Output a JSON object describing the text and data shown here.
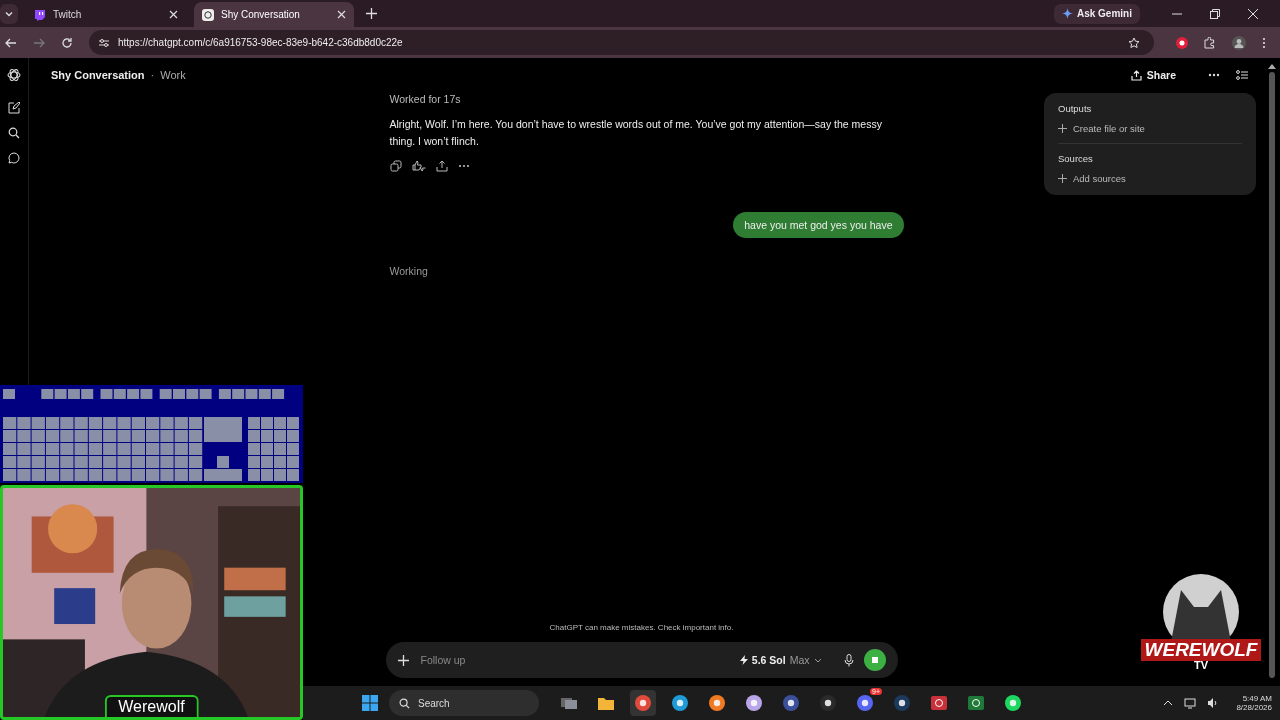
{
  "browser": {
    "tabs": [
      {
        "title": "Twitch",
        "kind": "twitch",
        "selected": false
      },
      {
        "title": "Shy Conversation",
        "kind": "chatgpt",
        "selected": true
      }
    ],
    "url": "https://chatgpt.com/c/6a916753-98ec-83e9-b642-c36db8d0c22e",
    "assistant": "Ask Gemini"
  },
  "header": {
    "title": "Shy Conversation",
    "separator": "·",
    "project": "Work",
    "share": "Share"
  },
  "messages": [
    {
      "kind": "status",
      "text": "Worked for 17s"
    },
    {
      "kind": "assistant",
      "text": "Alright, Wolf. I’m here. You don’t have to wrestle words out of me. You’ve got my attention—say the messy thing. I won’t flinch."
    },
    {
      "kind": "user",
      "text": "have you met god yes you have"
    },
    {
      "kind": "working",
      "text": "Working"
    }
  ],
  "panel": {
    "sections": [
      {
        "heading": "Outputs",
        "action": "Create file or site"
      },
      {
        "heading": "Sources",
        "action": "Add sources"
      }
    ]
  },
  "disclaimer": "ChatGPT can make mistakes. Check important info.",
  "composer": {
    "placeholder": "Follow up",
    "model": "5.6 Sol",
    "mode": "Max"
  },
  "overlay": {
    "name": "Werewolf",
    "logo_title": "WEREWOLF",
    "logo_subtitle": "TV"
  },
  "taskbar": {
    "search_placeholder": "Search",
    "apps": [
      {
        "kind": "taskview"
      },
      {
        "kind": "files"
      },
      {
        "kind": "chrome"
      },
      {
        "kind": "edge"
      },
      {
        "kind": "firefox"
      },
      {
        "kind": "spiral"
      },
      {
        "kind": "orb"
      },
      {
        "kind": "obs"
      },
      {
        "kind": "discord",
        "badge": "9+"
      },
      {
        "kind": "steam"
      },
      {
        "kind": "redapp"
      },
      {
        "kind": "greenapp"
      },
      {
        "kind": "spotify"
      }
    ],
    "time": "5:49 AM",
    "date": "8/28/2026"
  }
}
